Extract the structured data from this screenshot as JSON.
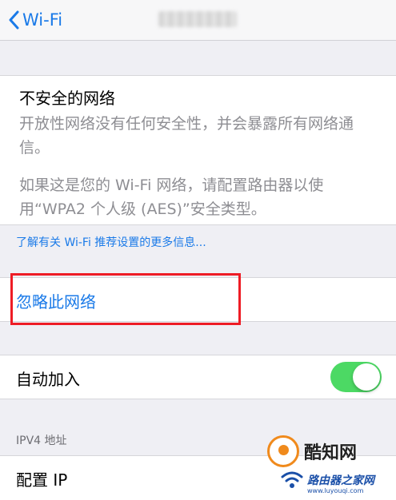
{
  "nav": {
    "back_label": "Wi-Fi"
  },
  "info": {
    "title": "不安全的网络",
    "paragraph1": "开放性网络没有任何安全性，并会暴露所有网络通信。",
    "paragraph2": "如果这是您的 Wi-Fi 网络，请配置路由器以使用“WPA2 个人级 (AES)”安全类型。"
  },
  "more_link": "了解有关 Wi-Fi 推荐设置的更多信息...",
  "forget": {
    "label": "忽略此网络"
  },
  "auto_join": {
    "label": "自动加入",
    "enabled": true
  },
  "ipv4": {
    "header": "IPV4 地址",
    "configure_ip_label": "配置 IP"
  },
  "watermark": {
    "brand": "酷知网",
    "site": "路由器之家网",
    "domain": "www.luyouqi.com"
  },
  "colors": {
    "accent": "#1a7ae8",
    "toggle_on": "#4cd964",
    "highlight": "#ee1c25",
    "background": "#efeff4"
  },
  "icons": {
    "back": "chevron-left-icon",
    "watermark_logo": "wifi-logo-icon"
  }
}
